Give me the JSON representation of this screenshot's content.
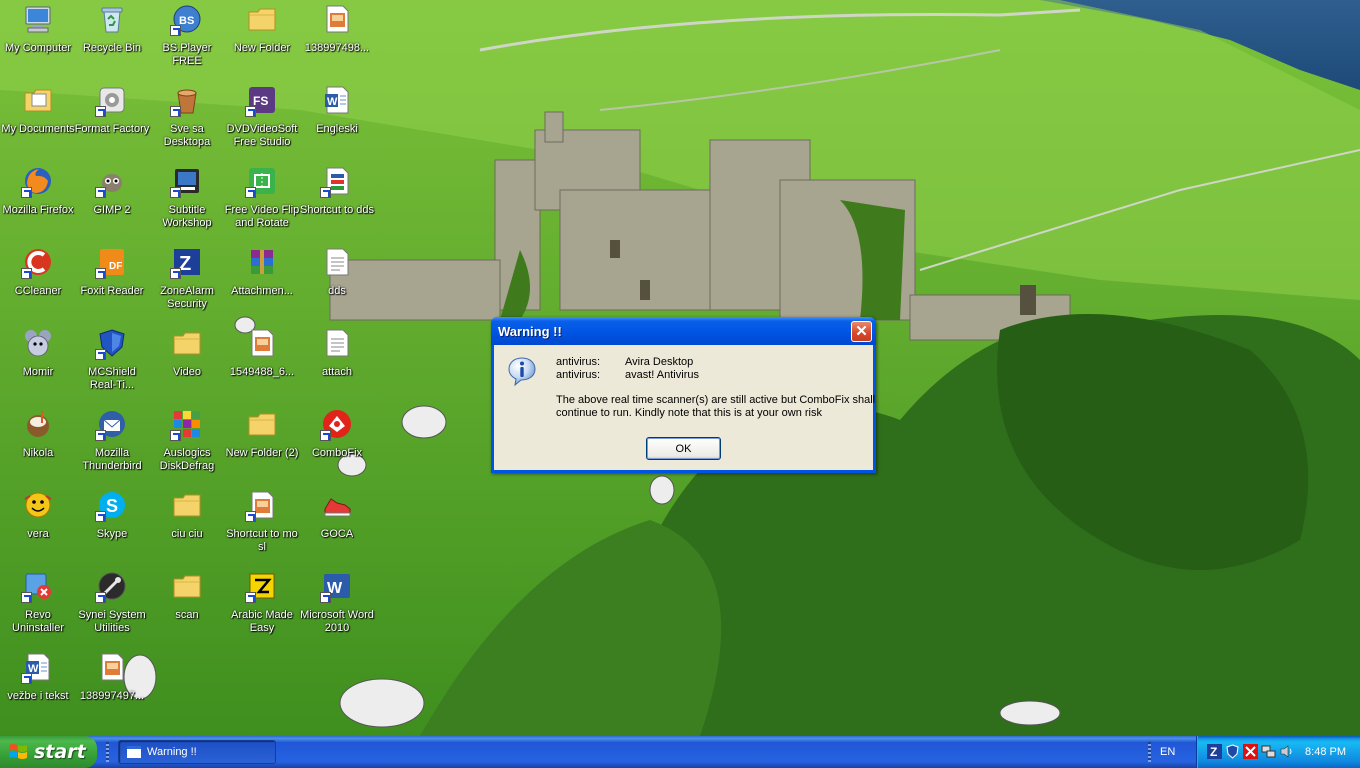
{
  "desktop": {
    "icons": [
      {
        "label": "My Computer",
        "icon": "computer-icon"
      },
      {
        "label": "Recycle Bin",
        "icon": "recycle-bin-icon"
      },
      {
        "label": "BS.Player FREE",
        "icon": "bsplayer-icon"
      },
      {
        "label": "New Folder",
        "icon": "folder-icon"
      },
      {
        "label": "138997498...",
        "icon": "image-file-icon"
      },
      {
        "label": "My Documents",
        "icon": "documents-folder-icon"
      },
      {
        "label": "Format Factory",
        "icon": "format-factory-icon"
      },
      {
        "label": "Sve sa Desktopa",
        "icon": "bucket-icon"
      },
      {
        "label": "DVDVideoSoft Free Studio",
        "icon": "dvdvideosoft-icon"
      },
      {
        "label": "Engleski",
        "icon": "word-document-icon"
      },
      {
        "label": "Mozilla Firefox",
        "icon": "firefox-icon"
      },
      {
        "label": "GIMP 2",
        "icon": "gimp-icon"
      },
      {
        "label": "Subtitle Workshop",
        "icon": "subtitle-workshop-icon"
      },
      {
        "label": "Free Video Flip and Rotate",
        "icon": "video-flip-icon"
      },
      {
        "label": "Shortcut to dds",
        "icon": "shortcut-file-icon"
      },
      {
        "label": "CCleaner",
        "icon": "ccleaner-icon"
      },
      {
        "label": "Foxit Reader",
        "icon": "foxit-reader-icon"
      },
      {
        "label": "ZoneAlarm Security",
        "icon": "zonealarm-icon"
      },
      {
        "label": "Attachmen...",
        "icon": "winrar-icon"
      },
      {
        "label": "dds",
        "icon": "text-file-icon"
      },
      {
        "label": "Momir",
        "icon": "mouse-character-icon"
      },
      {
        "label": "MCShield Real-Ti...",
        "icon": "mcshield-icon"
      },
      {
        "label": "Video",
        "icon": "folder-icon"
      },
      {
        "label": "1549488_6...",
        "icon": "image-file-icon"
      },
      {
        "label": "attach",
        "icon": "text-file-icon"
      },
      {
        "label": "Nikola",
        "icon": "coconut-icon"
      },
      {
        "label": "Mozilla Thunderbird",
        "icon": "thunderbird-icon"
      },
      {
        "label": "Auslogics DiskDefrag",
        "icon": "auslogics-icon"
      },
      {
        "label": "New Folder (2)",
        "icon": "folder-icon"
      },
      {
        "label": "ComboFix",
        "icon": "combofix-icon"
      },
      {
        "label": "vera",
        "icon": "smiley-icon"
      },
      {
        "label": "Skype",
        "icon": "skype-icon"
      },
      {
        "label": "ciu ciu",
        "icon": "folder-icon"
      },
      {
        "label": "Shortcut to mo sl",
        "icon": "image-file-icon"
      },
      {
        "label": "GOCA",
        "icon": "sneaker-icon"
      },
      {
        "label": "Revo Uninstaller",
        "icon": "revo-uninstaller-icon"
      },
      {
        "label": "Synei System Utilities",
        "icon": "synei-icon"
      },
      {
        "label": "scan",
        "icon": "folder-icon"
      },
      {
        "label": "Arabic Made Easy",
        "icon": "arabic-made-easy-icon"
      },
      {
        "label": "Microsoft Word 2010",
        "icon": "word-icon"
      },
      {
        "label": "vežbe i tekst",
        "icon": "word-document-icon"
      },
      {
        "label": "138997497...",
        "icon": "image-file-icon"
      }
    ]
  },
  "dialog": {
    "title": "Warning !!",
    "rows": [
      {
        "key": "antivirus:",
        "value": "Avira Desktop"
      },
      {
        "key": "antivirus:",
        "value": "avast! Antivirus"
      }
    ],
    "message": "The above real time scanner(s) are still active but ComboFix shall continue to run. Kindly note that this is at your own risk",
    "ok_label": "OK",
    "close_glyph": "✕"
  },
  "taskbar": {
    "start_label": "start",
    "task_items": [
      {
        "label": "Warning !!"
      }
    ],
    "language": "EN",
    "clock": "8:48 PM"
  },
  "colors": {
    "title_bar": "#0054e3",
    "dialog_body": "#ece9d8",
    "taskbar": "#245edb",
    "start_button": "#3c9a3c",
    "tray": "#0f88df"
  }
}
